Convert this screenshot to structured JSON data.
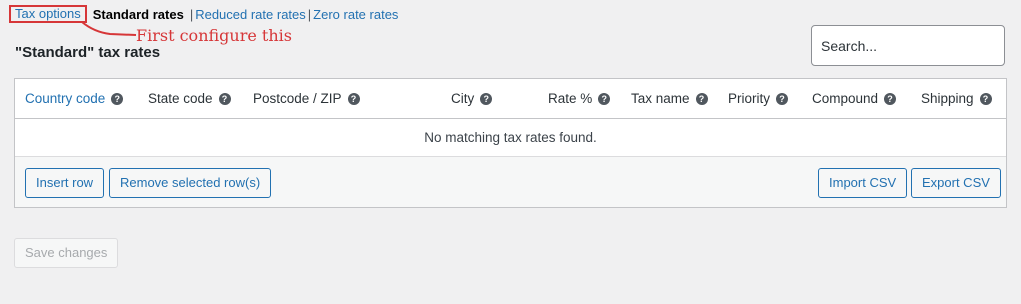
{
  "subnav": {
    "tax_options": "Tax options",
    "standard_rates": "Standard rates",
    "separator": "|",
    "reduced_rates": "Reduced rate rates",
    "zero_rates": "Zero rate rates"
  },
  "annotation": {
    "text": "First configure this",
    "color": "#d63638"
  },
  "heading": "\"Standard\" tax rates",
  "search": {
    "placeholder": "Search..."
  },
  "table": {
    "columns": [
      {
        "label": "Country code",
        "link": true
      },
      {
        "label": "State code"
      },
      {
        "label": "Postcode / ZIP"
      },
      {
        "label": "City"
      },
      {
        "label": "Rate %"
      },
      {
        "label": "Tax name"
      },
      {
        "label": "Priority"
      },
      {
        "label": "Compound"
      },
      {
        "label": "Shipping"
      }
    ],
    "help_glyph": "?",
    "empty_message": "No matching tax rates found."
  },
  "buttons": {
    "insert_row": "Insert row",
    "remove_rows": "Remove selected row(s)",
    "import_csv": "Import CSV",
    "export_csv": "Export CSV",
    "save_changes": "Save changes"
  },
  "colors": {
    "accent": "#2271b1",
    "annotation": "#d63638",
    "background": "#f0f0f1"
  }
}
